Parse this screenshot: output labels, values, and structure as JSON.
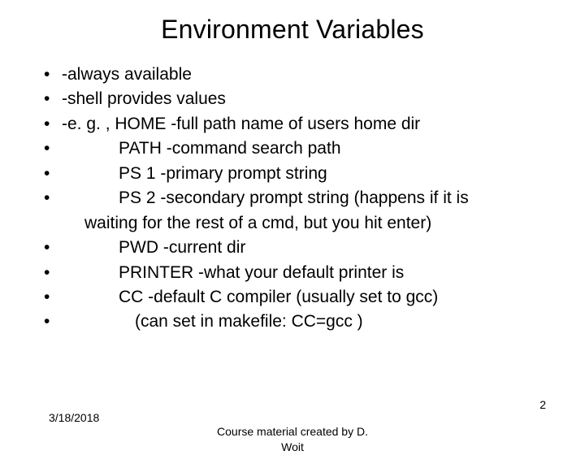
{
  "title": "Environment Variables",
  "bullets": {
    "b0": "-always available",
    "b1": "-shell provides values",
    "b2": "-e. g. , HOME  -full path name of users home dir",
    "b3": "PATH  -command search path",
    "b4": "PS 1  -primary prompt string",
    "b5": "PS 2  -secondary prompt string (happens if it is",
    "b5wrap": "waiting for the rest of a cmd, but you hit enter)",
    "b6": "PWD   -current dir",
    "b7": "PRINTER  -what your default printer is",
    "b8": "CC   -default C compiler (usually set to gcc)",
    "b9": "(can set in makefile: CC=gcc )"
  },
  "footer": {
    "date": "3/18/2018",
    "center_line1": "Course material created by D.",
    "center_line2": "Woit",
    "page": "2"
  }
}
